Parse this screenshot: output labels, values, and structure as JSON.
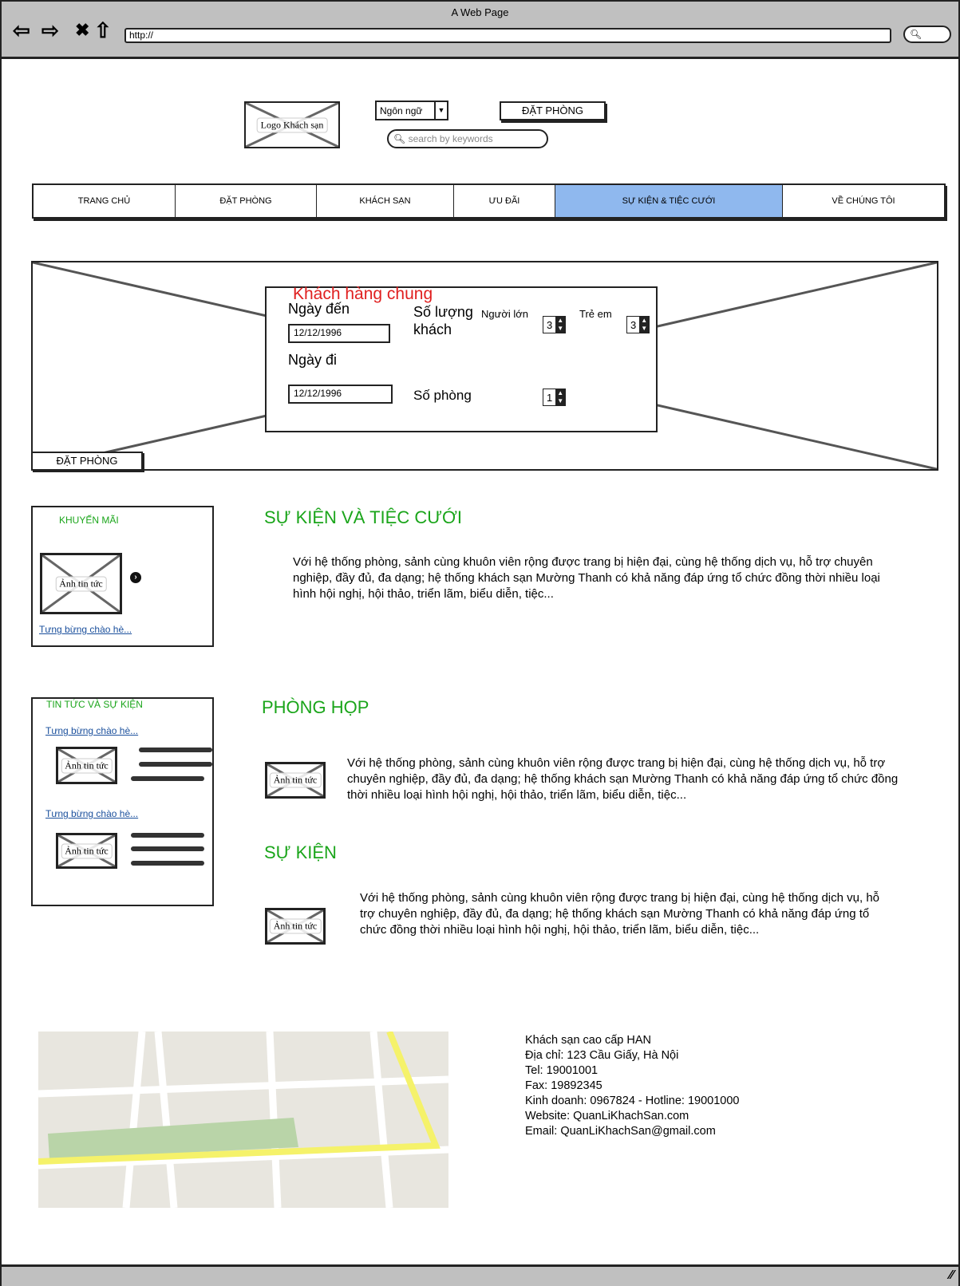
{
  "browser": {
    "title": "A Web Page",
    "url": "http://",
    "icons": [
      "back-icon",
      "forward-icon",
      "close-icon",
      "home-icon",
      "search-icon"
    ]
  },
  "header": {
    "logo_label": "Logo Khách sạn",
    "language_select": "Ngôn ngữ",
    "book_button": "ĐẶT PHÒNG",
    "search_placeholder": "search by keywords"
  },
  "nav": {
    "items": [
      {
        "label": "TRANG CHỦ"
      },
      {
        "label": "ĐẶT PHÒNG"
      },
      {
        "label": "KHÁCH SẠN"
      },
      {
        "label": "ƯU ĐÃI"
      },
      {
        "label": "SỰ KIỆN & TIỆC CƯỚI",
        "active": true
      },
      {
        "label": "VỀ CHÚNG TÔI"
      }
    ],
    "active_color": "#8fb8ee"
  },
  "booking": {
    "title": "Khách hàng chung",
    "arrival_label": "Ngày đến",
    "arrival_value": "12/12/1996",
    "departure_label": "Ngày đi",
    "departure_value": "12/12/1996",
    "guests_label": "Số lượng",
    "guests_label2": "khách",
    "adults_label": "Người lớn",
    "adults_value": "3",
    "children_label": "Trẻ em",
    "children_value": "3",
    "rooms_label": "Số phòng",
    "rooms_value": "1",
    "book_button": "ĐẶT PHÒNG"
  },
  "sidebar": {
    "promo": {
      "title": "KHUYẾN MÃI",
      "image_label": "Ảnh tin tức",
      "link": "Tưng bừng chào hè..."
    },
    "news": {
      "title": "TIN TỨC VÀ SỰ KIỆN",
      "items": [
        {
          "link": "Tưng bừng chào hè...",
          "image_label": "Ảnh tin tức"
        },
        {
          "link": "Tưng bừng chào hè...",
          "image_label": "Ảnh tin tức"
        }
      ]
    }
  },
  "main": {
    "sections": [
      {
        "title": "SỰ KIỆN VÀ TIỆC CƯỚI",
        "text": "Với hệ thống phòng, sảnh cùng khuôn viên rộng được trang bị hiện đại, cùng hệ thống dịch vụ, hỗ trợ chuyên nghiệp, đầy đủ, đa dạng; hệ thống khách sạn Mường Thanh có khả năng đáp ứng tổ chức đồng thời nhiều loại hình hội nghị, hội thảo, triển lãm, biểu diễn, tiệc..."
      },
      {
        "title": "PHÒNG HỌP",
        "image_label": "Ảnh tin tức",
        "text": "Với hệ thống phòng, sảnh cùng khuôn viên rộng được trang bị hiện đại, cùng hệ thống dịch vụ, hỗ trợ chuyên nghiệp, đầy đủ, đa dạng; hệ thống khách sạn Mường Thanh có khả năng đáp ứng tổ chức đồng thời nhiều loại hình hội nghị, hội thảo, triển lãm, biểu diễn, tiệc..."
      },
      {
        "title": "SỰ KIỆN",
        "image_label": "Ảnh tin tức",
        "text": "Với hệ thống phòng, sảnh cùng khuôn viên rộng được trang bị hiện đại, cùng hệ thống dịch vụ, hỗ trợ chuyên nghiệp, đầy đủ, đa dạng; hệ thống khách sạn Mường Thanh có khả năng đáp ứng tổ chức đồng thời nhiều loại hình hội nghị, hội thảo, triển lãm, biểu diễn, tiệc..."
      }
    ],
    "heading_color": "#1aa51a"
  },
  "footer": {
    "lines": [
      "Khách sạn cao cấp HAN",
      "Địa chỉ: 123 Cầu Giấy, Hà Nội",
      "Tel: 19001001",
      "Fax: 19892345",
      "Kinh doanh: 0967824 - Hotline: 19001000",
      "Website: QuanLiKhachSan.com",
      "Email: QuanLiKhachSan@gmail.com"
    ]
  }
}
